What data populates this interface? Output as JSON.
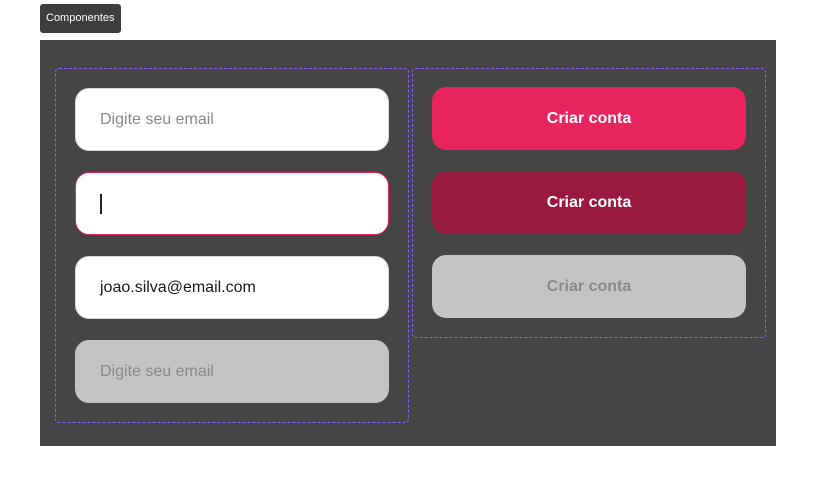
{
  "frame": {
    "label": "Componentes"
  },
  "inputs": {
    "default_placeholder": "Digite seu email",
    "filled_value": "joao.silva@email.com",
    "disabled_placeholder": "Digite seu email"
  },
  "buttons": {
    "primary_label": "Criar conta",
    "hover_label": "Criar conta",
    "disabled_label": "Criar conta"
  },
  "colors": {
    "canvas": "#454545",
    "group_outline": "#8b5cf6",
    "brand": "#e8245f",
    "brand_dark": "#991940",
    "disabled": "#c4c4c4"
  }
}
